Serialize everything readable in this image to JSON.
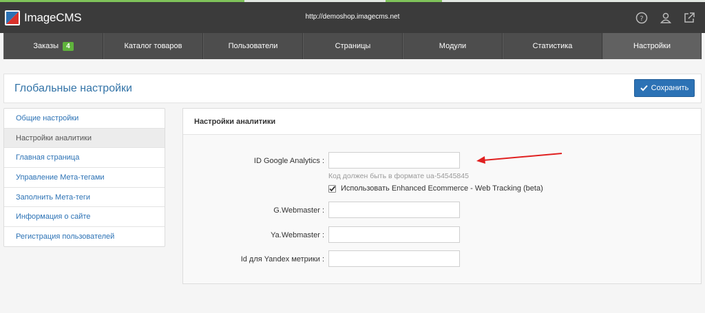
{
  "app": {
    "name": "ImageCMS",
    "url": "http://demoshop.imagecms.net"
  },
  "header_icons": [
    "help-icon",
    "user-icon",
    "external-link-icon"
  ],
  "nav": {
    "items": [
      {
        "label": "Заказы",
        "badge": "4"
      },
      {
        "label": "Каталог товаров"
      },
      {
        "label": "Пользователи"
      },
      {
        "label": "Страницы"
      },
      {
        "label": "Модули"
      },
      {
        "label": "Статистика"
      },
      {
        "label": "Настройки",
        "active": true
      }
    ]
  },
  "page": {
    "title": "Глобальные настройки",
    "save_label": "Сохранить"
  },
  "sidebar": {
    "items": [
      {
        "label": "Общие настройки"
      },
      {
        "label": "Настройки аналитики",
        "active": true
      },
      {
        "label": "Главная страница"
      },
      {
        "label": "Управление Мета-тегами"
      },
      {
        "label": "Заполнить Мета-теги"
      },
      {
        "label": "Информация о сайте"
      },
      {
        "label": "Регистрация пользователей"
      }
    ]
  },
  "panel": {
    "title": "Настройки аналитики",
    "fields": {
      "ga": {
        "label": "ID Google Analytics :",
        "value": "",
        "hint": "Код должен быть в формате ua-54545845"
      },
      "enhanced": {
        "label": "Использовать Enhanced Ecommerce - Web Tracking (beta)",
        "checked": true
      },
      "gwm": {
        "label": "G.Webmaster :",
        "value": ""
      },
      "ywm": {
        "label": "Ya.Webmaster :",
        "value": ""
      },
      "ym": {
        "label": "Id для Yandex метрики :",
        "value": ""
      }
    }
  },
  "colors": {
    "accent": "#2c72b5",
    "badge": "#5fb33c",
    "annotation_arrow": "#e02020"
  }
}
